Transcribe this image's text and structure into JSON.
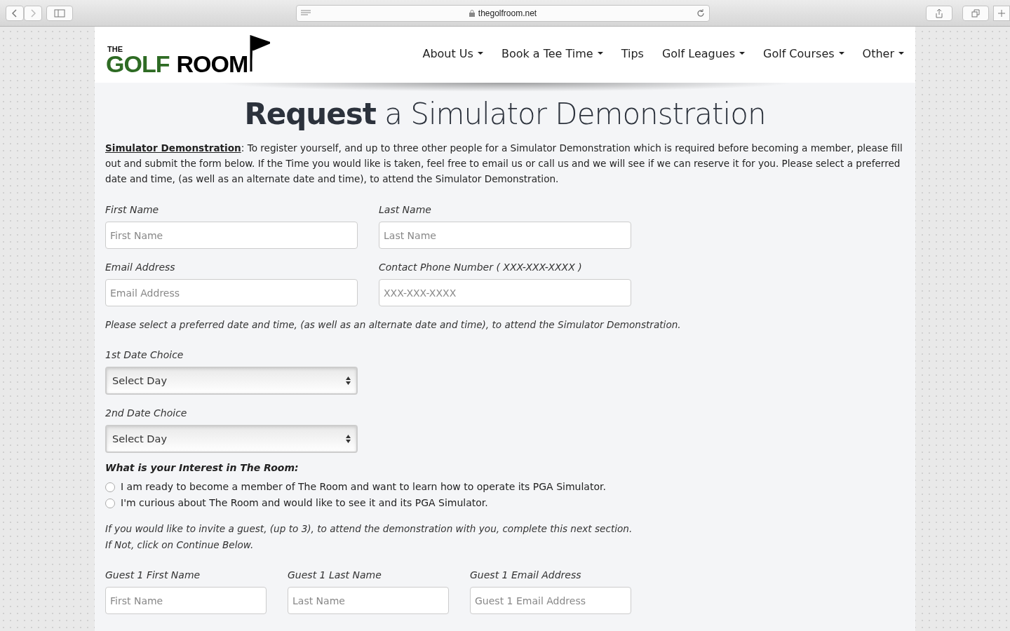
{
  "browser": {
    "url": "thegolfroom.net"
  },
  "logo": {
    "small": "THE",
    "word1": "GOLF",
    "word2": "ROOM"
  },
  "nav": [
    {
      "label": "About Us",
      "dropdown": true
    },
    {
      "label": "Book a Tee Time",
      "dropdown": true
    },
    {
      "label": "Tips",
      "dropdown": false
    },
    {
      "label": "Golf Leagues",
      "dropdown": true
    },
    {
      "label": "Golf Courses",
      "dropdown": true
    },
    {
      "label": "Other",
      "dropdown": true
    }
  ],
  "title": "**Request** a Simulator Demonstration",
  "intro": "**Simulator Demonstration**: To register yourself, and up to three other people for a Simulator Demonstration which is required before becoming a member, please fill out and submit the form below. If the Time you would like is taken, feel free to email us or call us and we will see if we can reserve it for you. Please select a preferred date and time, (as well as an alternate date and time), to attend the Simulator Demonstration.",
  "field_rows": [
    [
      {
        "label": "First Name",
        "placeholder": "First Name"
      },
      {
        "label": "Last Name",
        "placeholder": "Last Name"
      }
    ],
    [
      {
        "label": "Email Address",
        "placeholder": "Email Address"
      },
      {
        "label": "Contact Phone Number ( XXX-XXX-XXXX )",
        "placeholder": "XXX-XXX-XXXX"
      }
    ]
  ],
  "schedule_note": "Please select a preferred date and time, (as well as an alternate date and time), to attend the Simulator Demonstration.",
  "date_choices": [
    {
      "label": "1st Date Choice",
      "value": "Select Day"
    },
    {
      "label": "2nd Date Choice",
      "value": "Select Day"
    }
  ],
  "interest": {
    "heading": "What is your Interest in The Room:",
    "options": [
      {
        "label": "I am ready to become a member of The Room and want to learn how to operate its PGA Simulator.",
        "selected": false
      },
      {
        "label": "I'm curious about The Room and would like to see it and its PGA Simulator.",
        "selected": false
      }
    ]
  },
  "guest_note": "If you would like to invite a guest, (up to 3), to attend the demonstration with you, complete this next section. If Not, click on Continue Below.",
  "guest_fields": [
    {
      "label": "Guest 1 First Name",
      "placeholder": "First Name"
    },
    {
      "label": "Guest 1 Last Name",
      "placeholder": "Last Name"
    },
    {
      "label": "Guest 1 Email Address",
      "placeholder": "Guest 1 Email Address"
    }
  ]
}
